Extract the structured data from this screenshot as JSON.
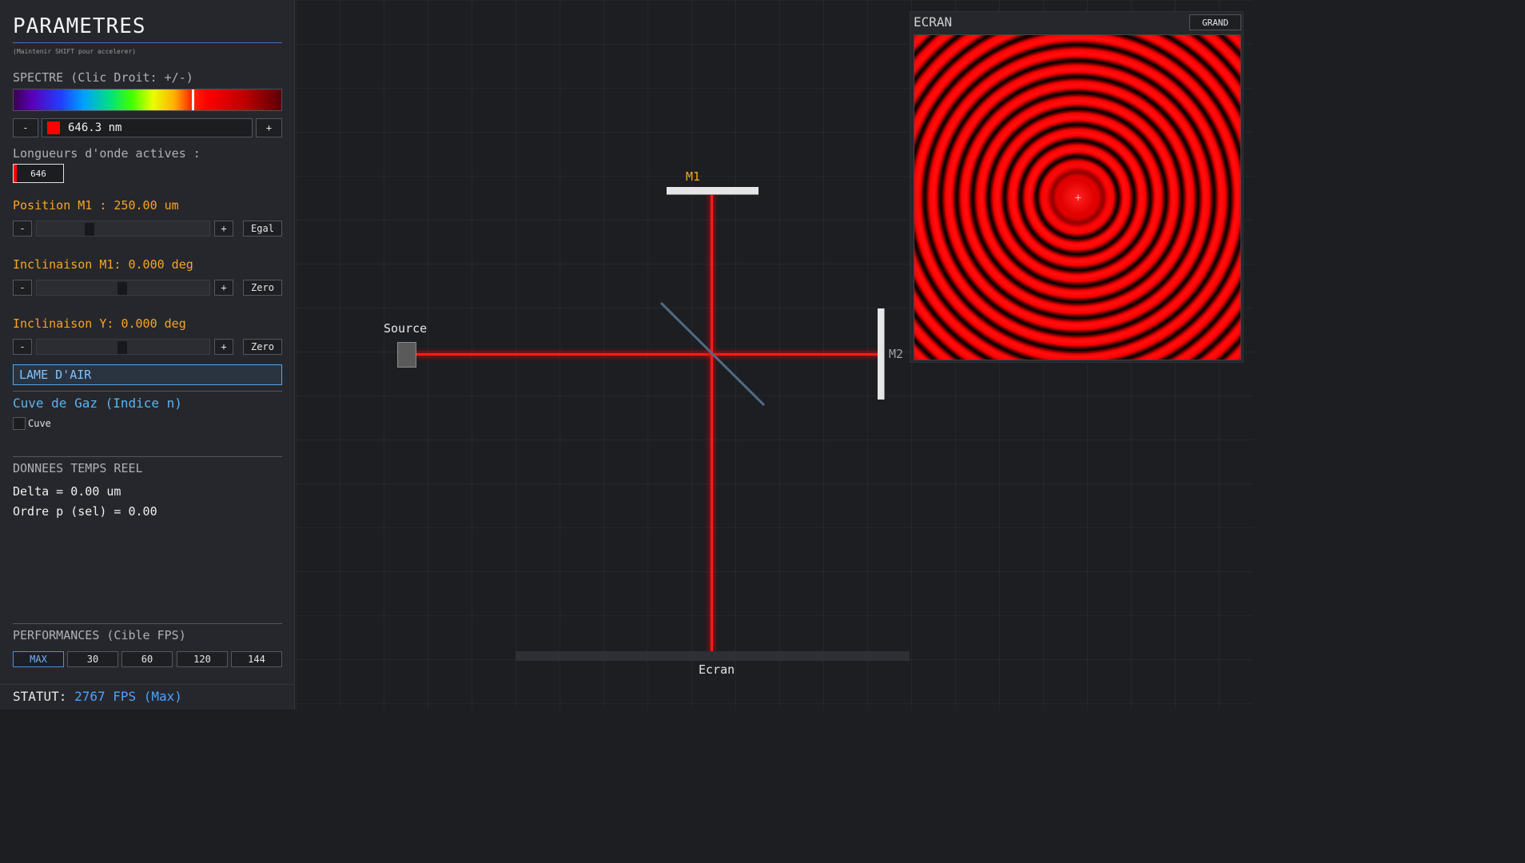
{
  "panel": {
    "title": "PARAMETRES",
    "hint": "(Maintenir SHIFT pour accelerer)",
    "spectrum_label": "SPECTRE (Clic Droit: +/-)",
    "spectrum_marker_fraction": 0.664,
    "wavelength": {
      "minus": "-",
      "value": "646.3 nm",
      "plus": "+",
      "swatch_color": "#ff0000"
    },
    "active_label": "Longueurs d'onde actives :",
    "active_chips": [
      "646"
    ],
    "position_m1": {
      "label": "Position M1 : 250.00 um",
      "minus": "-",
      "plus": "+",
      "action": "Egal",
      "fraction": 0.3
    },
    "inclinaison_m1": {
      "label": "Inclinaison M1: 0.000 deg",
      "minus": "-",
      "plus": "+",
      "action": "Zero",
      "fraction": 0.5
    },
    "inclinaison_y": {
      "label": "Inclinaison Y: 0.000 deg",
      "minus": "-",
      "plus": "+",
      "action": "Zero",
      "fraction": 0.5
    },
    "mode": "LAME D'AIR",
    "cuve_title": "Cuve de Gaz (Indice n)",
    "cuve_check_label": "Cuve",
    "cuve_checked": false,
    "data_title": "DONNEES TEMPS REEL",
    "delta": "Delta = 0.00 um",
    "ordre": "Ordre p (sel) = 0.00",
    "perf_title": "PERFORMANCES (Cible FPS)",
    "fps_options": [
      "MAX",
      "30",
      "60",
      "120",
      "144"
    ],
    "fps_selected": "MAX",
    "status_label": "STATUT:",
    "status_value": "2767 FPS (Max)"
  },
  "bench": {
    "m1_label": "M1",
    "m2_label": "M2",
    "source_label": "Source",
    "ecran_label": "Ecran",
    "beam_color": "#ff1a1a"
  },
  "screen": {
    "title": "ECRAN",
    "size_button": "GRAND",
    "crosshair": "+"
  }
}
